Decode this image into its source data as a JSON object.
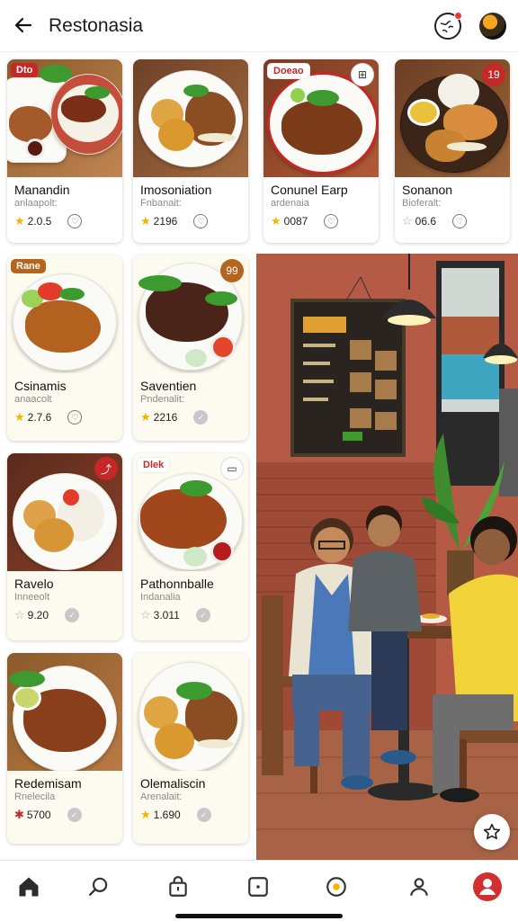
{
  "header": {
    "title": "Restonasia"
  },
  "cards": [
    {
      "name": "Manandin",
      "sub": "anlaapolt:",
      "rating": "2.0.5",
      "badge": "Dto",
      "star": "gold",
      "action": "heart"
    },
    {
      "name": "Imosoniation",
      "sub": "Fnbanait:",
      "rating": "2196",
      "badge": "",
      "star": "gold",
      "action": "heart"
    },
    {
      "name": "Conunel Earp",
      "sub": "ardenaia",
      "rating": "0087",
      "badge": "Doeao",
      "corner": "⊞",
      "star": "gold",
      "action": "heart"
    },
    {
      "name": "Sonanon",
      "sub": "Bioferalt:",
      "rating": "06.6",
      "corner": "19",
      "star": "grey",
      "action": "heart"
    },
    {
      "name": "Csinamis",
      "sub": "anaacolt",
      "rating": "2.7.6",
      "badge": "Rane",
      "star": "gold",
      "action": "heart"
    },
    {
      "name": "Saventien",
      "sub": "Pndenalit:",
      "rating": "2216",
      "corner": "99",
      "star": "gold",
      "action": "check"
    },
    {
      "name": "Ravelo",
      "sub": "Inneeolt",
      "rating": "9.20",
      "corner": "⤴",
      "star": "grey",
      "action": "check"
    },
    {
      "name": "Pathonnballe",
      "sub": "Indanalia",
      "rating": "3.011",
      "badge": "Dlek",
      "corner": "▭",
      "star": "grey",
      "action": "check"
    },
    {
      "name": "Redemisam",
      "sub": "Rnelecila",
      "rating": "5700",
      "star": "red",
      "action": "check"
    },
    {
      "name": "Olemaliscin",
      "sub": "Arenalait:",
      "rating": "1.690",
      "star": "gold",
      "action": "check"
    }
  ],
  "nav": [
    "home-icon",
    "search-icon",
    "bag-icon",
    "square-icon",
    "compass-icon",
    "profile-icon",
    "account-icon"
  ],
  "accent": "#d32f2f"
}
